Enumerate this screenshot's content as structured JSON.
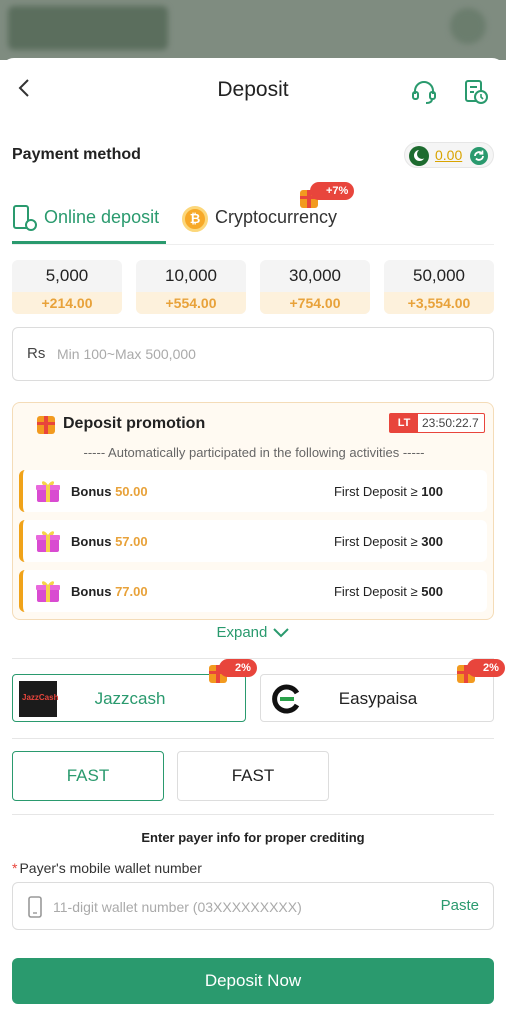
{
  "header": {
    "title": "Deposit",
    "back_icon": "chevron-left-icon",
    "support_icon": "headset-icon",
    "history_icon": "history-icon"
  },
  "payment_method": {
    "label": "Payment method",
    "balance": "0.00",
    "flag_icon": "pakistan-flag-icon",
    "refresh_icon": "refresh-icon"
  },
  "tabs": [
    {
      "label": "Online deposit",
      "active": true
    },
    {
      "label": "Cryptocurrency",
      "active": false,
      "promo": "+7%"
    }
  ],
  "amounts": [
    {
      "value": "5,000",
      "bonus": "+214.00"
    },
    {
      "value": "10,000",
      "bonus": "+554.00"
    },
    {
      "value": "30,000",
      "bonus": "+754.00"
    },
    {
      "value": "50,000",
      "bonus": "+3,554.00"
    }
  ],
  "amount_input": {
    "currency": "Rs",
    "placeholder": "Min 100~Max 500,000"
  },
  "promotion": {
    "title": "Deposit promotion",
    "timer_badge": "LT",
    "timer": "23:50:22.7",
    "subtitle": "----- Automatically participated in the following activities -----",
    "items": [
      {
        "label": "Bonus",
        "value": "50.00",
        "condition": "First Deposit ≥",
        "threshold": "100"
      },
      {
        "label": "Bonus",
        "value": "57.00",
        "condition": "First Deposit ≥",
        "threshold": "300"
      },
      {
        "label": "Bonus",
        "value": "77.00",
        "condition": "First Deposit ≥",
        "threshold": "500"
      }
    ],
    "expand_label": "Expand"
  },
  "channels": [
    {
      "name": "Jazzcash",
      "logo_text": "JazzCash",
      "promo": "2%",
      "active": true
    },
    {
      "name": "Easypaisa",
      "promo": "2%",
      "active": false
    }
  ],
  "speeds": [
    {
      "label": "FAST",
      "active": true
    },
    {
      "label": "FAST",
      "active": false
    }
  ],
  "payer": {
    "note": "Enter payer info for proper crediting",
    "field_label": "Payer's mobile wallet number",
    "required_mark": "*",
    "placeholder": "11-digit wallet number (03XXXXXXXXX)",
    "paste_label": "Paste"
  },
  "submit_label": "Deposit Now",
  "colors": {
    "accent": "#2a9a6e",
    "bonus": "#e8a23a",
    "promo_red": "#e8453c"
  }
}
